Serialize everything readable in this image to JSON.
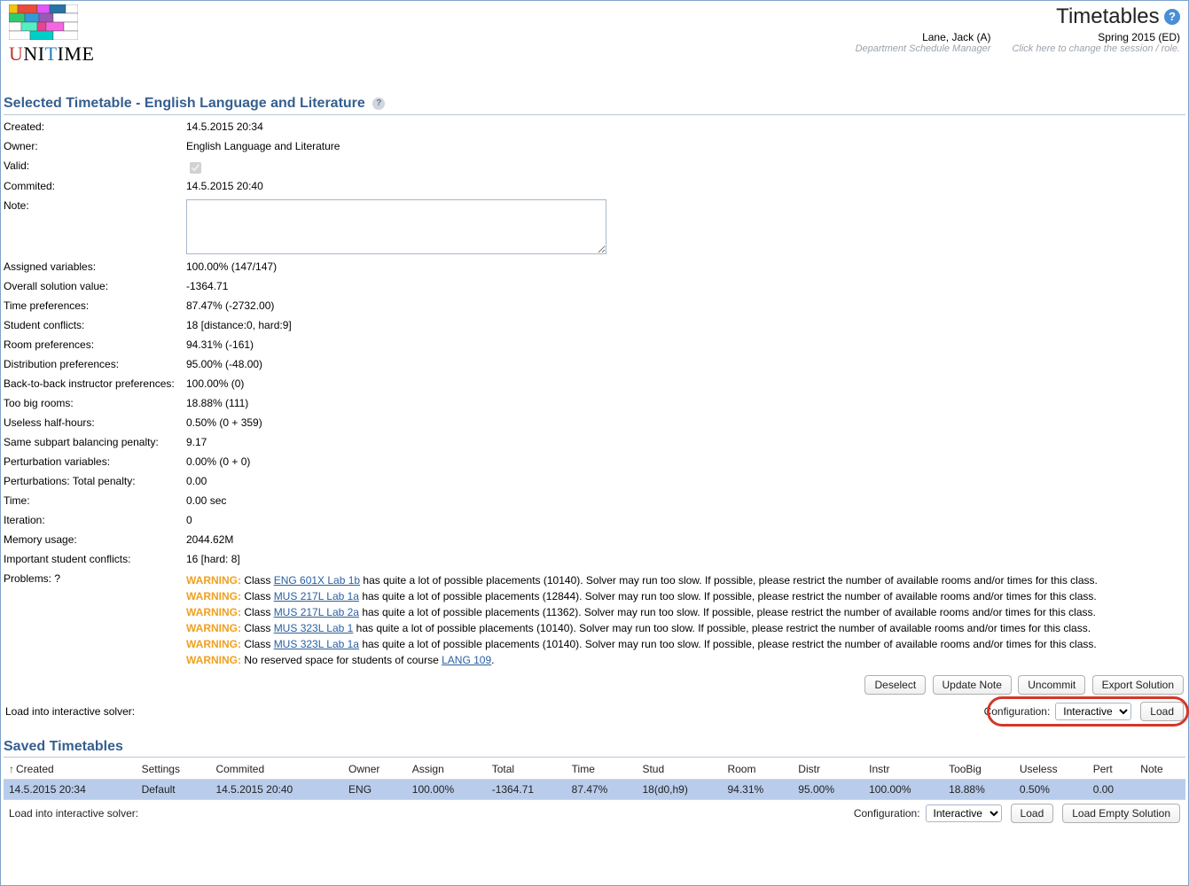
{
  "header": {
    "app_title": "Timetables",
    "user_name": "Lane, Jack (A)",
    "user_role": "Department Schedule Manager",
    "term": "Spring 2015 (ED)",
    "term_hint": "Click here to change the session / role."
  },
  "section_title": "Selected Timetable - English Language and Literature",
  "details": {
    "created_label": "Created:",
    "created_value": "14.5.2015 20:34",
    "owner_label": "Owner:",
    "owner_value": "English Language and Literature",
    "valid_label": "Valid:",
    "commited_label": "Commited:",
    "commited_value": "14.5.2015 20:40",
    "note_label": "Note:",
    "note_value": "",
    "assigned_label": "Assigned variables:",
    "assigned_value": "100.00% (147/147)",
    "overall_label": "Overall solution value:",
    "overall_value": "-1364.71",
    "timepref_label": "Time preferences:",
    "timepref_value": "87.47% (-2732.00)",
    "sconf_label": "Student conflicts:",
    "sconf_value": "18 [distance:0, hard:9]",
    "roompref_label": "Room preferences:",
    "roompref_value": "94.31% (-161)",
    "distpref_label": "Distribution preferences:",
    "distpref_value": "95.00% (-48.00)",
    "b2b_label": "Back-to-back instructor preferences:",
    "b2b_value": "100.00% (0)",
    "toobig_label": "Too big rooms:",
    "toobig_value": "18.88% (111)",
    "useless_label": "Useless half-hours:",
    "useless_value": "0.50% (0 + 359)",
    "subpart_label": "Same subpart balancing penalty:",
    "subpart_value": "9.17",
    "pertvar_label": "Perturbation variables:",
    "pertvar_value": "0.00% (0 + 0)",
    "perttot_label": "Perturbations: Total penalty:",
    "perttot_value": "0.00",
    "time_label": "Time:",
    "time_value": "0.00 sec",
    "iter_label": "Iteration:",
    "iter_value": "0",
    "mem_label": "Memory usage:",
    "mem_value": "2044.62M",
    "impconf_label": "Important student conflicts:",
    "impconf_value": "16 [hard: 8]",
    "problems_label": "Problems:"
  },
  "problems": [
    {
      "prefix": "WARNING:",
      "pre": "Class ",
      "link": "ENG 601X Lab 1b",
      "post": " has quite a lot of possible placements (10140). Solver may run too slow. If possible, please restrict the number of available rooms and/or times for this class."
    },
    {
      "prefix": "WARNING:",
      "pre": "Class ",
      "link": "MUS 217L Lab 1a",
      "post": " has quite a lot of possible placements (12844). Solver may run too slow. If possible, please restrict the number of available rooms and/or times for this class."
    },
    {
      "prefix": "WARNING:",
      "pre": "Class ",
      "link": "MUS 217L Lab 2a",
      "post": " has quite a lot of possible placements (11362). Solver may run too slow. If possible, please restrict the number of available rooms and/or times for this class."
    },
    {
      "prefix": "WARNING:",
      "pre": "Class ",
      "link": "MUS 323L Lab 1",
      "post": " has quite a lot of possible placements (10140). Solver may run too slow. If possible, please restrict the number of available rooms and/or times for this class."
    },
    {
      "prefix": "WARNING:",
      "pre": "Class ",
      "link": "MUS 323L Lab 1a",
      "post": " has quite a lot of possible placements (10140). Solver may run too slow. If possible, please restrict the number of available rooms and/or times for this class."
    },
    {
      "prefix": "WARNING:",
      "pre": "No reserved space for students of course ",
      "link": "LANG 109",
      "post": "."
    }
  ],
  "buttons": {
    "deselect": "Deselect",
    "update_note": "Update Note",
    "uncommit": "Uncommit",
    "export_solution": "Export Solution",
    "load": "Load",
    "load_empty": "Load Empty Solution"
  },
  "load_interactive_label": "Load into interactive solver:",
  "config_label": "Configuration:",
  "config_value": "Interactive",
  "saved_title": "Saved Timetables",
  "columns": [
    "Created",
    "Settings",
    "Commited",
    "Owner",
    "Assign",
    "Total",
    "Time",
    "Stud",
    "Room",
    "Distr",
    "Instr",
    "TooBig",
    "Useless",
    "Pert",
    "Note"
  ],
  "rows": [
    {
      "Created": "14.5.2015 20:34",
      "Settings": "Default",
      "Commited": "14.5.2015 20:40",
      "Owner": "ENG",
      "Assign": "100.00%",
      "Total": "-1364.71",
      "Time": "87.47%",
      "Stud": "18(d0,h9)",
      "Room": "94.31%",
      "Distr": "95.00%",
      "Instr": "100.00%",
      "TooBig": "18.88%",
      "Useless": "0.50%",
      "Pert": "0.00",
      "Note": ""
    }
  ]
}
